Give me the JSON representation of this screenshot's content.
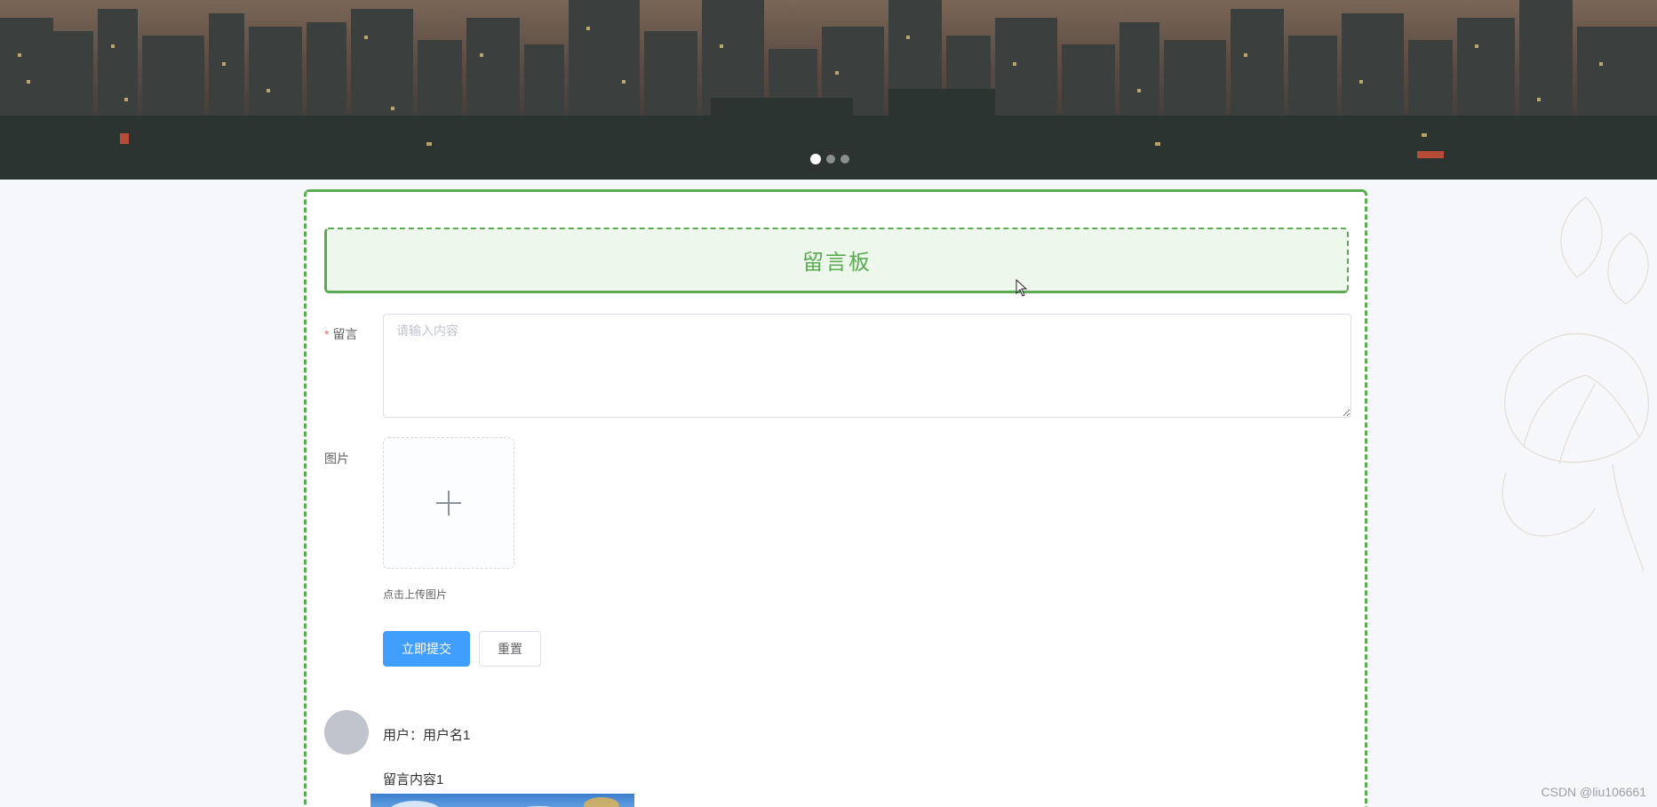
{
  "banner": {
    "slide_count": 3,
    "active_slide": 0
  },
  "board": {
    "title": "留言板",
    "form": {
      "message_label": "留言",
      "message_required_mark": "*",
      "message_placeholder": "请输入内容",
      "message_value": "",
      "image_label": "图片",
      "upload_icon": "plus-icon",
      "upload_tip": "点击上传图片",
      "submit_label": "立即提交",
      "reset_label": "重置"
    },
    "comments": [
      {
        "user": "用户：用户名1",
        "content": "留言内容1"
      }
    ]
  },
  "watermark": "CSDN @liu106661",
  "colors": {
    "accent_green": "#5aab52",
    "header_bg": "#eef7eb",
    "primary_blue": "#409eff",
    "required_red": "#f56c6c"
  }
}
